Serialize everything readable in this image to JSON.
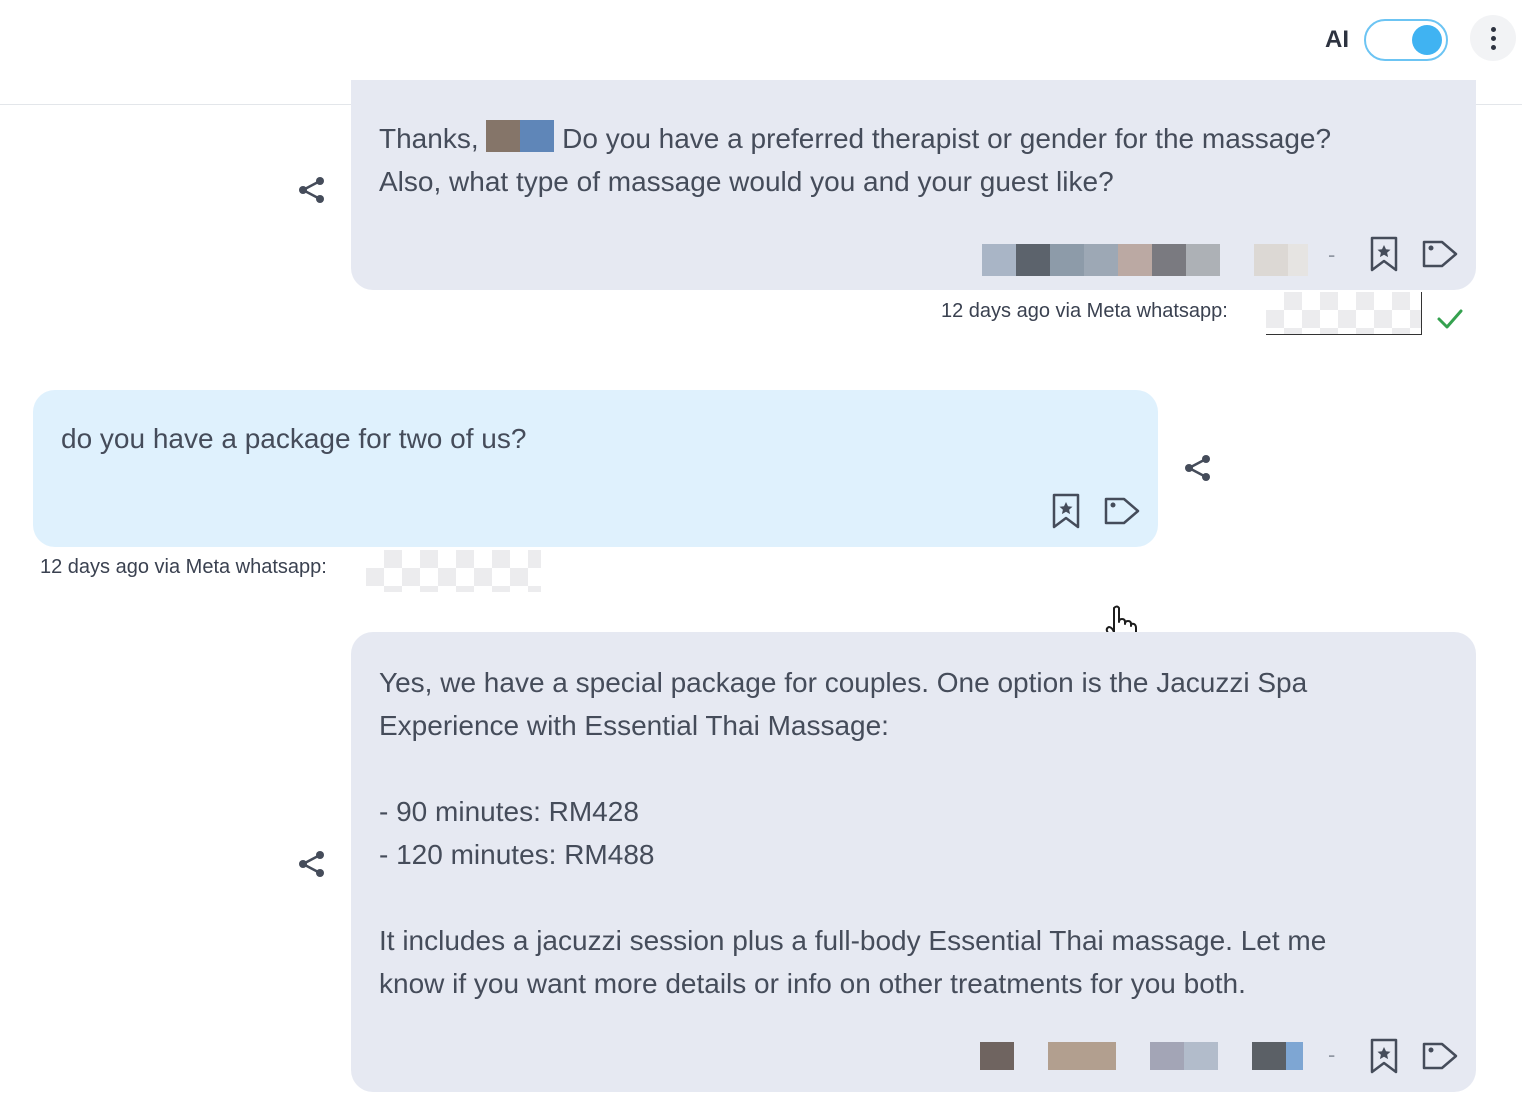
{
  "header": {
    "ai_label": "AI",
    "ai_toggle_on": true,
    "more_icon": "vertical-dots-icon"
  },
  "colors": {
    "outgoing_bubble": "#e6e9f2",
    "incoming_bubble": "#dff1fd",
    "toggle_accent": "#40b3f2",
    "read_check": "#35a14f"
  },
  "messages": [
    {
      "direction": "outgoing",
      "text_before_name": "Thanks, ",
      "text_after_name": " Do you have a preferred therapist or gender for the massage?\nAlso, what type of massage would you and your guest like?",
      "sender_separator": "-",
      "meta": "12 days ago via Meta whatsapp:",
      "status": "delivered"
    },
    {
      "direction": "incoming",
      "text": "do you have a package for two of us?",
      "meta": "12 days ago via Meta whatsapp:"
    },
    {
      "direction": "outgoing",
      "text": "Yes, we have a special package for couples. One option is the Jacuzzi Spa\nExperience with Essential Thai Massage:\n\n- 90 minutes: RM428\n- 120 minutes: RM488\n\nIt includes a jacuzzi session plus a full-body Essential Thai massage. Let me\nknow if you want more details or info on other treatments for you both.",
      "sender_separator": "-"
    }
  ]
}
